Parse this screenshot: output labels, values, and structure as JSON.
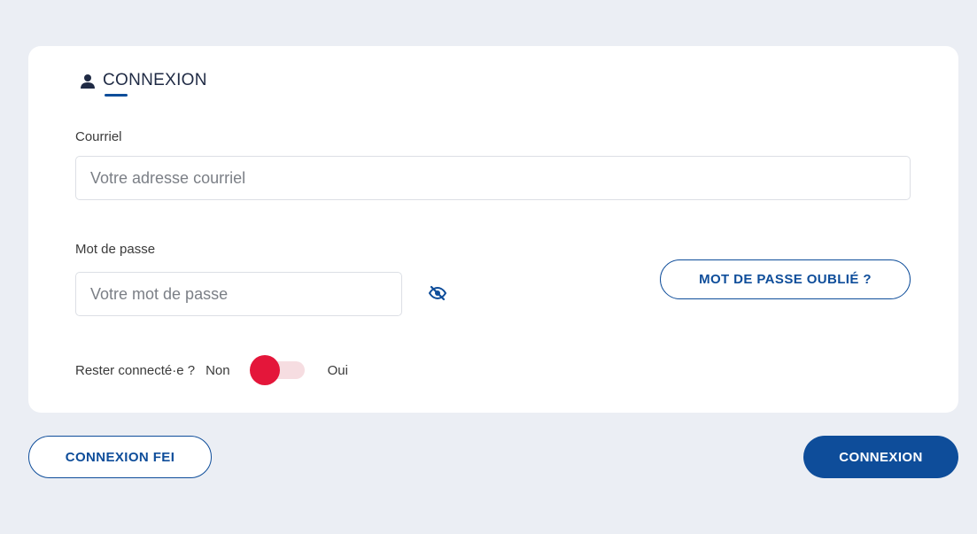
{
  "login": {
    "title": "CONNEXION",
    "user_icon": "user-icon",
    "email": {
      "label": "Courriel",
      "placeholder": "Votre adresse courriel",
      "value": ""
    },
    "password": {
      "label": "Mot de passe",
      "placeholder": "Votre mot de passe",
      "value": "",
      "visibility_icon": "eye-slash-icon"
    },
    "forgot_password_label": "MOT DE PASSE OUBLIÉ ?",
    "stay_connected": {
      "label": "Rester connecté·e ?",
      "off_label": "Non",
      "on_label": "Oui",
      "state": "Non"
    }
  },
  "actions": {
    "fei_label": "CONNEXION FEI",
    "submit_label": "CONNEXION"
  },
  "colors": {
    "brand_blue": "#0e4d9a",
    "toggle_red": "#e4163a",
    "background": "#ebeef4"
  }
}
